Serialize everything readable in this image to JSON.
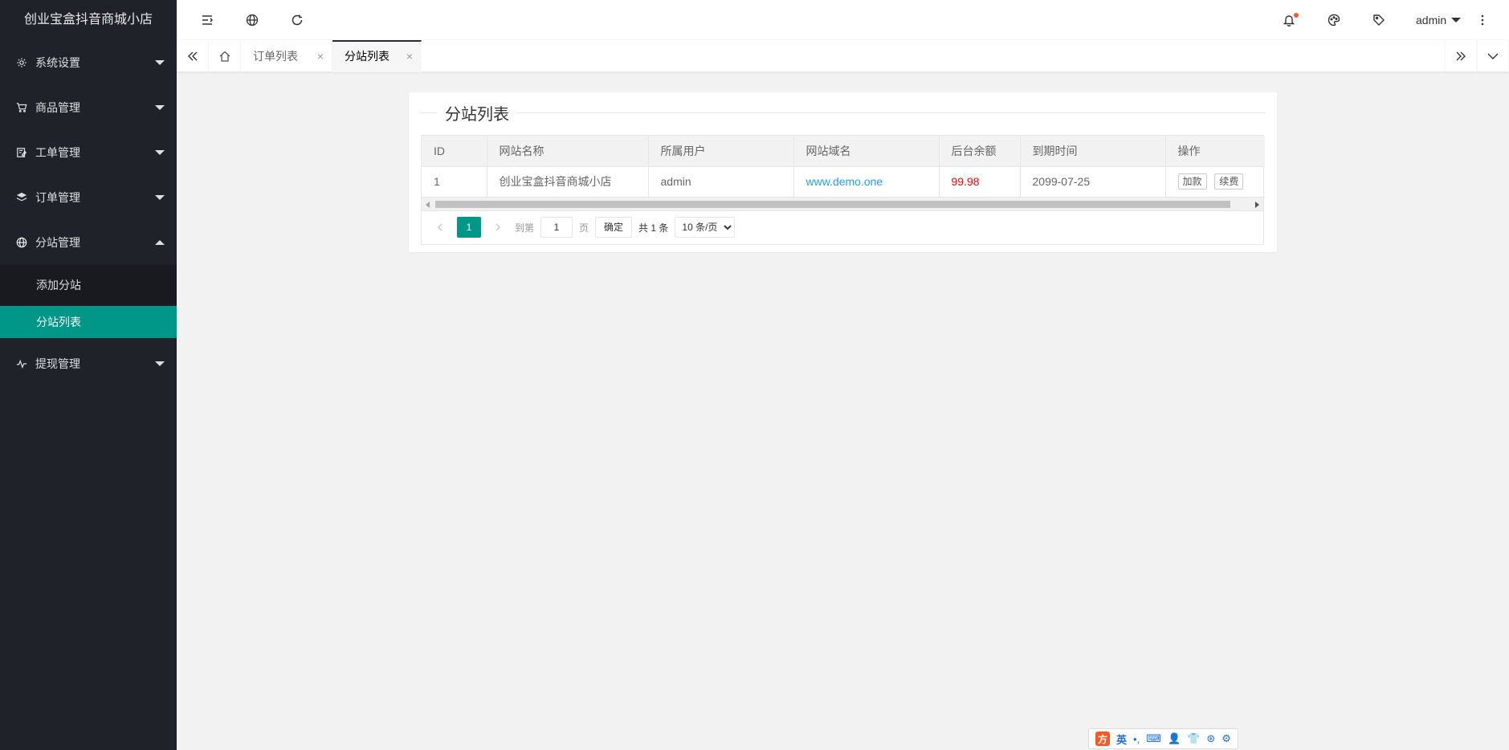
{
  "app": {
    "title": "创业宝盒抖音商城小店"
  },
  "sidebar": {
    "items": [
      {
        "label": "系统设置",
        "icon": "gear-icon"
      },
      {
        "label": "商品管理",
        "icon": "cart-icon"
      },
      {
        "label": "工单管理",
        "icon": "ticket-icon"
      },
      {
        "label": "订单管理",
        "icon": "layers-icon"
      },
      {
        "label": "分站管理",
        "icon": "globe-icon"
      },
      {
        "label": "提现管理",
        "icon": "pulse-icon"
      }
    ],
    "subitems": [
      {
        "label": "添加分站"
      },
      {
        "label": "分站列表"
      }
    ]
  },
  "header": {
    "user": "admin",
    "icons": [
      "menu-fold-icon",
      "globe-icon",
      "refresh-icon",
      "bell-icon",
      "palette-icon",
      "tag-icon",
      "more-icon"
    ]
  },
  "tabs": {
    "items": [
      {
        "label": "订单列表",
        "close": "×"
      },
      {
        "label": "分站列表",
        "close": "×"
      }
    ]
  },
  "card": {
    "title": "分站列表"
  },
  "table": {
    "columns": [
      "ID",
      "网站名称",
      "所属用户",
      "网站域名",
      "后台余额",
      "到期时间",
      "操作"
    ],
    "rows": [
      {
        "id": "1",
        "name": "创业宝盒抖音商城小店",
        "user": "admin",
        "domain": "www.demo.one",
        "balance": "99.98",
        "expire": "2099-07-25",
        "actions": [
          "加款",
          "续费"
        ]
      }
    ]
  },
  "pager": {
    "current": "1",
    "goto_label": "到第",
    "page_input": "1",
    "page_unit": "页",
    "confirm": "确定",
    "total": "共 1 条",
    "per_page": "10 条/页"
  },
  "ime": {
    "brand": "方",
    "mode": "英"
  },
  "colors": {
    "accent": "#009688",
    "sidebar": "#20222a",
    "link": "#1e9fff",
    "money": "#ff0000"
  }
}
